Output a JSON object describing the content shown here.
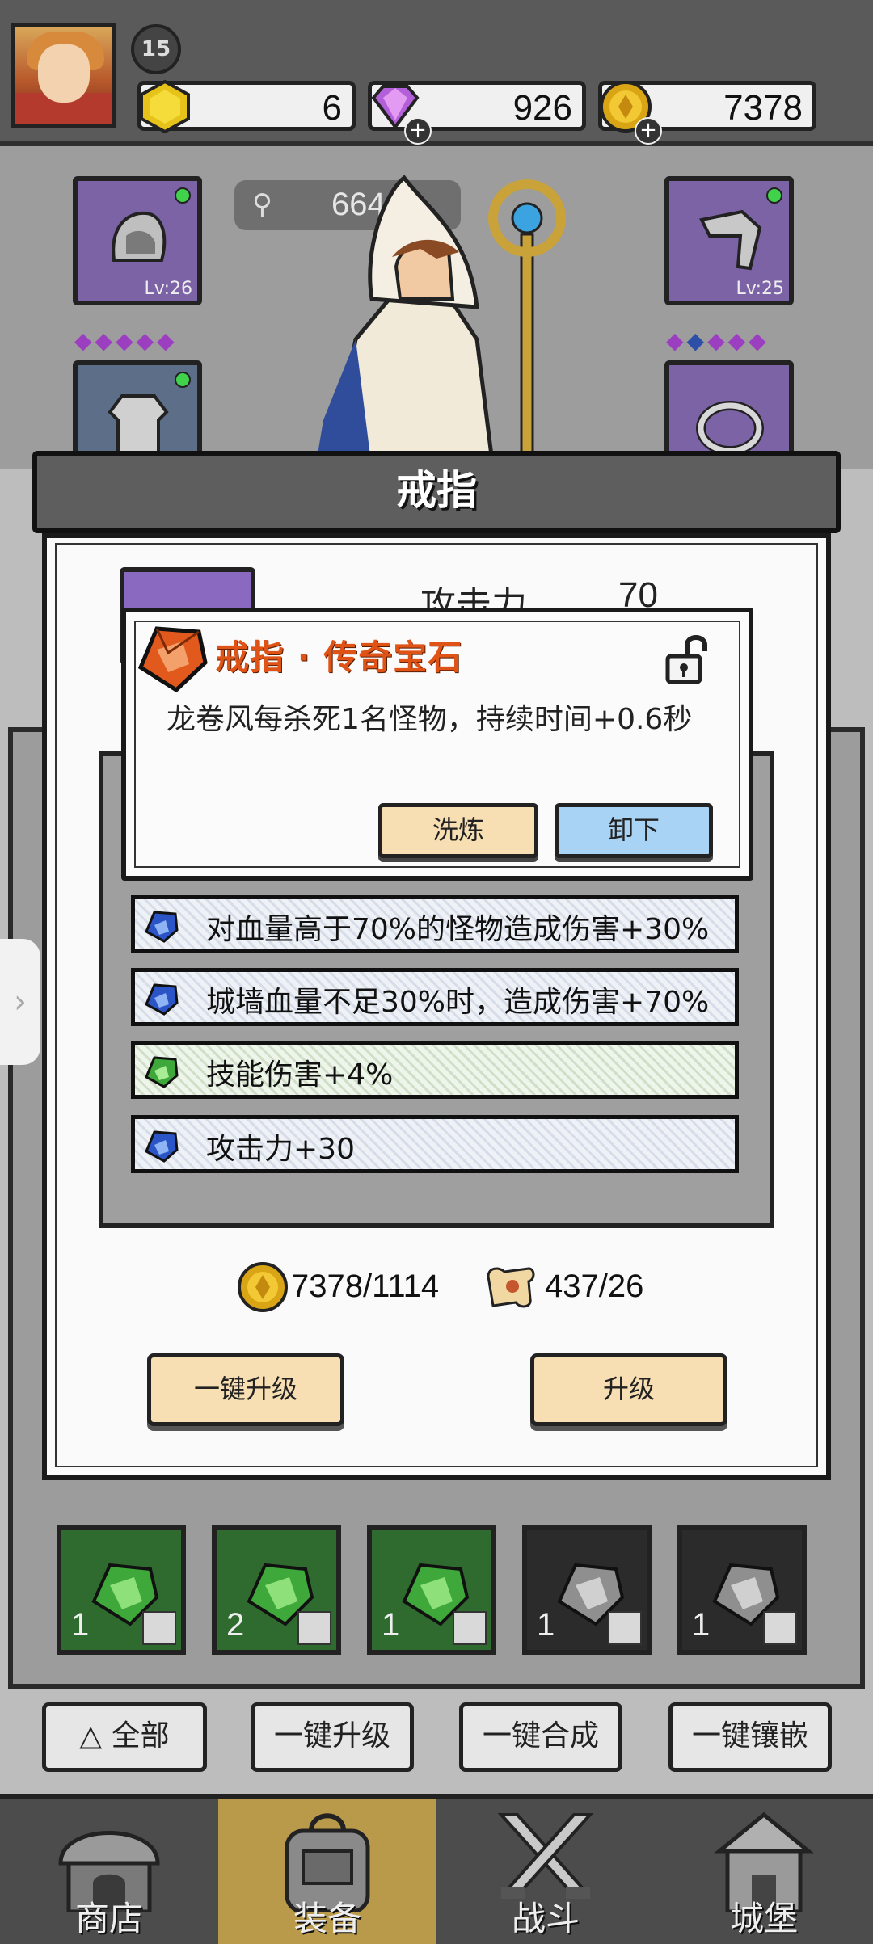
{
  "player": {
    "level": "15"
  },
  "resources": [
    {
      "name": "energy",
      "value": "6",
      "icon": "gold-hexagon-icon",
      "has_plus": false
    },
    {
      "name": "gems",
      "value": "926",
      "icon": "purple-diamond-icon",
      "has_plus": true
    },
    {
      "name": "coins",
      "value": "7378",
      "icon": "gold-coin-icon",
      "has_plus": true
    }
  ],
  "power": {
    "value": "664"
  },
  "equipment": {
    "helmet": {
      "level": "Lv:26"
    },
    "pants": {
      "level": "Lv:25"
    }
  },
  "modal": {
    "title": "戒指",
    "attack_label": "攻击力",
    "attack_value": "70",
    "gem_stats": [
      {
        "text": "对血量高于70%的怪物造成伤害+30%",
        "gem_color": "blue"
      },
      {
        "text": "城墙血量不足30%时，造成伤害+70%",
        "gem_color": "blue"
      },
      {
        "text": "技能伤害+4%",
        "gem_color": "green"
      },
      {
        "text": "攻击力+30",
        "gem_color": "blue"
      }
    ],
    "coin_cost": "7378/1114",
    "scroll_cost": "437/26",
    "one_key_upgrade": "一键升级",
    "upgrade": "升级"
  },
  "popup": {
    "title": "戒指 · 传奇宝石",
    "description": "龙卷风每杀死1名怪物，持续时间+0.6秒",
    "refine_button": "洗炼",
    "unequip_button": "卸下"
  },
  "inventory": [
    {
      "count": "1",
      "type": "green"
    },
    {
      "count": "2",
      "type": "green"
    },
    {
      "count": "1",
      "type": "green"
    },
    {
      "count": "1",
      "type": "grey"
    },
    {
      "count": "1",
      "type": "grey"
    }
  ],
  "actions": {
    "all": "全部",
    "one_key_upgrade": "一键升级",
    "one_key_merge": "一键合成",
    "one_key_inlay": "一键镶嵌"
  },
  "nav": [
    {
      "label": "商店",
      "icon": "shop-icon"
    },
    {
      "label": "装备",
      "icon": "backpack-icon"
    },
    {
      "label": "战斗",
      "icon": "crossed-swords-icon"
    },
    {
      "label": "城堡",
      "icon": "castle-icon"
    }
  ],
  "colors": {
    "popup_title": "#e05316",
    "modal_panel": "#fafafa",
    "active_tab": "#b89a4a"
  }
}
